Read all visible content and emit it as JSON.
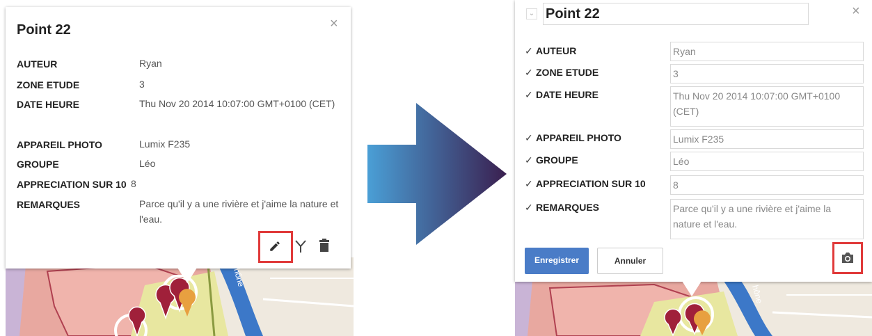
{
  "left_popup": {
    "title": "Point 22",
    "close": "×",
    "fields": [
      {
        "label": "AUTEUR",
        "value": "Ryan"
      },
      {
        "label": "ZONE ETUDE",
        "value": "3"
      },
      {
        "label": "DATE HEURE",
        "value": "Thu Nov 20 2014 10:07:00 GMT+0100 (CET)"
      },
      {
        "label": "APPAREIL PHOTO",
        "value": "Lumix F235"
      },
      {
        "label": "GROUPE",
        "value": "Léo"
      },
      {
        "label": "APPRECIATION SUR 10",
        "value": "8"
      },
      {
        "label": "REMARQUES",
        "value": "Parce qu'il y a une rivière et j'aime la nature et l'eau."
      }
    ],
    "actions": [
      "pencil-icon",
      "fork-icon",
      "trash-icon"
    ]
  },
  "right_popup": {
    "title": "Point 22",
    "close": "×",
    "check": "✓",
    "fields": [
      {
        "label": "AUTEUR",
        "value": "Ryan"
      },
      {
        "label": "ZONE ETUDE",
        "value": "3"
      },
      {
        "label": "DATE HEURE",
        "value": "Thu Nov 20 2014 10:07:00 GMT+0100 (CET)"
      },
      {
        "label": "APPAREIL PHOTO",
        "value": "Lumix F235"
      },
      {
        "label": "GROUPE",
        "value": "Léo"
      },
      {
        "label": "APPRECIATION SUR 10",
        "value": "8"
      },
      {
        "label": "REMARQUES",
        "value": "Parce qu'il y a une rivière et j'aime la nature et l'eau."
      }
    ],
    "save_label": "Enregistrer",
    "cancel_label": "Annuler",
    "camera_icon": "camera-icon"
  },
  "map_label": "hône",
  "colors": {
    "highlight": "#e03a3a",
    "save_button": "#4a7cc7",
    "arrow_start": "#4a9fd6",
    "arrow_end": "#3a1f4f"
  }
}
